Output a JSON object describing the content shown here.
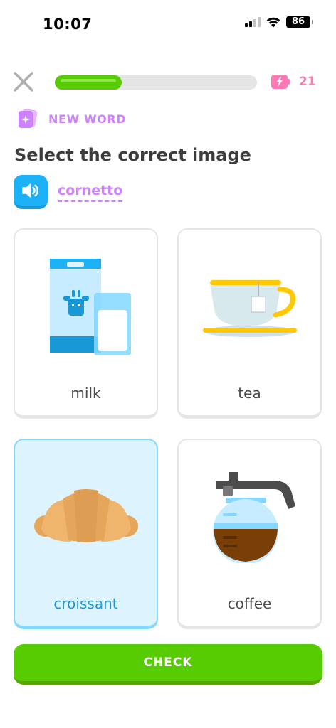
{
  "status_bar": {
    "time": "10:07",
    "battery": "86"
  },
  "progress": {
    "fraction": 0.33
  },
  "energy": {
    "count": "21"
  },
  "badge": {
    "label": "NEW WORD"
  },
  "prompt": {
    "title": "Select the correct image",
    "word": "cornetto"
  },
  "choices": [
    {
      "label": "milk",
      "icon": "milk-carton-glass-icon",
      "selected": false
    },
    {
      "label": "tea",
      "icon": "tea-cup-icon",
      "selected": false
    },
    {
      "label": "croissant",
      "icon": "croissant-icon",
      "selected": true
    },
    {
      "label": "coffee",
      "icon": "coffee-pot-icon",
      "selected": false
    }
  ],
  "check": {
    "label": "CHECK"
  },
  "colors": {
    "green": "#58cc02",
    "blue": "#1cb0f6",
    "purple": "#ce82ff",
    "pink": "#ff7ab4"
  }
}
